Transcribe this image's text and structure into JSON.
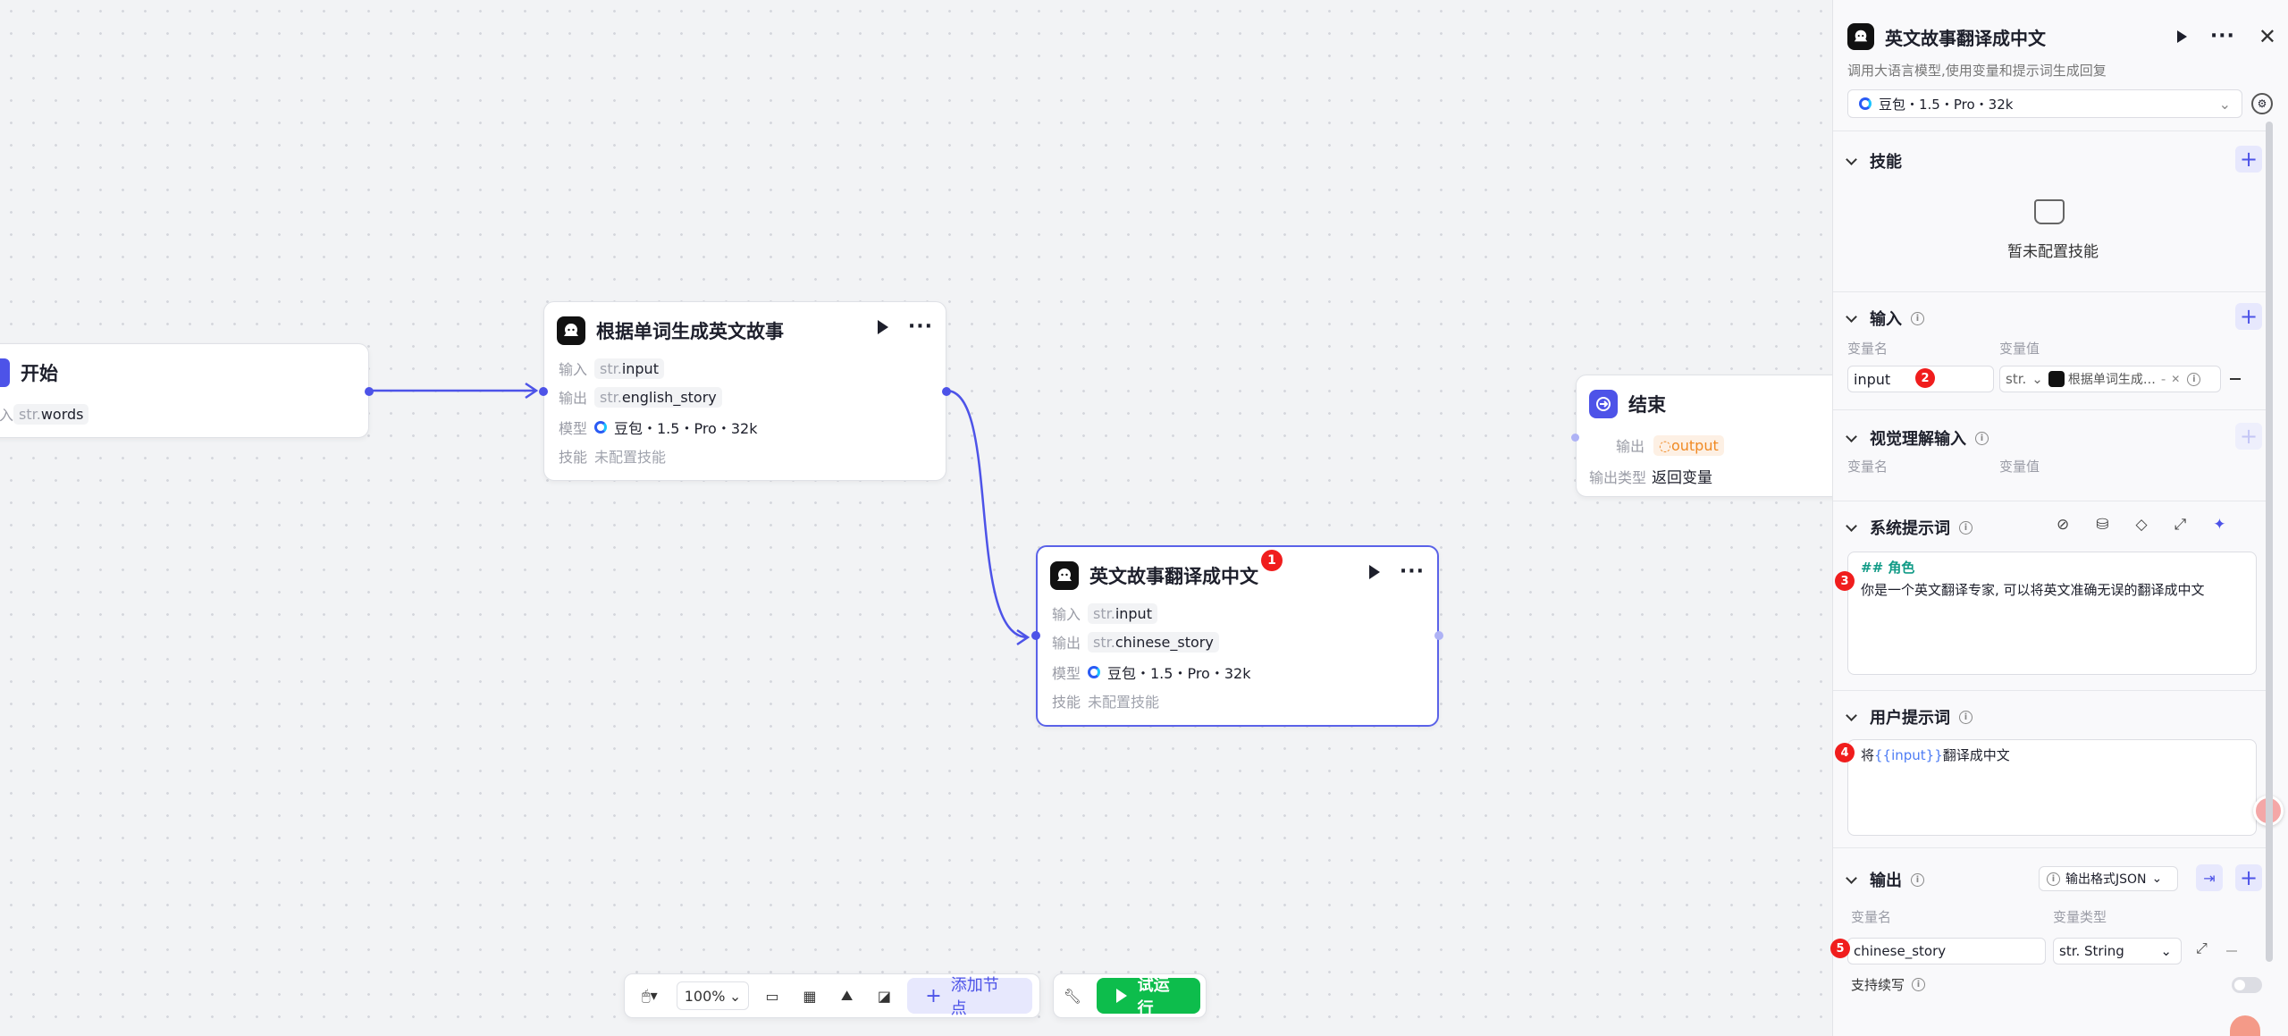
{
  "nodes": {
    "start": {
      "title": "开始",
      "input_label": "入",
      "input_type": "str.",
      "input_var": "words"
    },
    "gen": {
      "title": "根据单词生成英文故事",
      "input_label": "输入",
      "input_type": "str.",
      "input_var": "input",
      "output_label": "输出",
      "output_type": "str.",
      "output_var": "english_story",
      "model_label": "模型",
      "model_value": "豆包・1.5・Pro・32k",
      "skill_label": "技能",
      "skill_value": "未配置技能"
    },
    "translate": {
      "title": "英文故事翻译成中文",
      "badge": "1",
      "input_label": "输入",
      "input_type": "str.",
      "input_var": "input",
      "output_label": "输出",
      "output_type": "str.",
      "output_var": "chinese_story",
      "model_label": "模型",
      "model_value": "豆包・1.5・Pro・32k",
      "skill_label": "技能",
      "skill_value": "未配置技能"
    },
    "end": {
      "title": "结束",
      "output_label": "输出",
      "output_var": "output",
      "output_type_label": "输出类型",
      "output_type_value": "返回变量"
    }
  },
  "toolbar": {
    "zoom": "100%",
    "add_node": "添加节点",
    "run": "试运行"
  },
  "panel": {
    "title": "英文故事翻译成中文",
    "subtitle": "调用大语言模型,使用变量和提示词生成回复",
    "model": "豆包・1.5・Pro・32k",
    "skills": {
      "title": "技能",
      "empty": "暂未配置技能"
    },
    "input": {
      "title": "输入",
      "col_name": "变量名",
      "col_value": "变量值",
      "var_name": "input",
      "badge": "2",
      "type": "str.",
      "ref_value": "根据单词生成…",
      "ref_suffix": "-"
    },
    "vision": {
      "title": "视觉理解输入",
      "col_name": "变量名",
      "col_value": "变量值"
    },
    "system_prompt": {
      "title": "系统提示词",
      "badge": "3",
      "heading": "## 角色",
      "body": "你是一个英文翻译专家, 可以将英文准确无误的翻译成中文"
    },
    "user_prompt": {
      "title": "用户提示词",
      "badge": "4",
      "prefix": "将",
      "var": "{{input}}",
      "suffix": "翻译成中文"
    },
    "output": {
      "title": "输出",
      "format": "输出格式JSON",
      "col_name": "变量名",
      "col_type": "变量类型",
      "var_name": "chinese_story",
      "badge": "5",
      "var_type": "str. String",
      "continue_label": "支持续写"
    }
  },
  "colors": {
    "accent": "#4d53e8",
    "run": "#0dbd4c",
    "badge": "#f01d1d",
    "output_tag": "#f49d4a"
  }
}
